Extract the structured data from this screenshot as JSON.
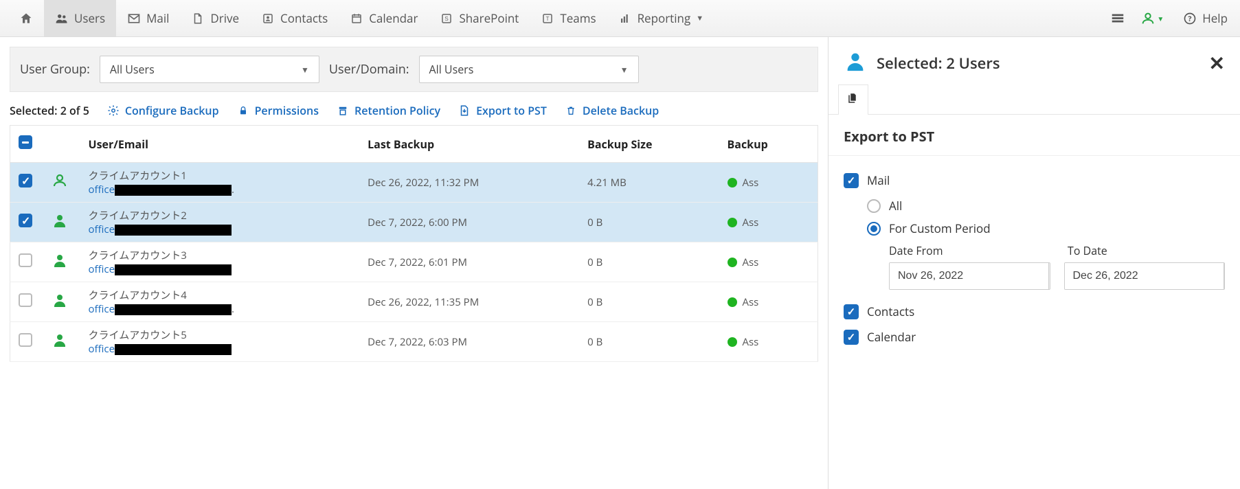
{
  "nav": {
    "items": [
      {
        "label": "",
        "icon": "home"
      },
      {
        "label": "Users",
        "icon": "users",
        "active": true
      },
      {
        "label": "Mail",
        "icon": "mail"
      },
      {
        "label": "Drive",
        "icon": "file"
      },
      {
        "label": "Contacts",
        "icon": "id-card"
      },
      {
        "label": "Calendar",
        "icon": "calendar"
      },
      {
        "label": "SharePoint",
        "icon": "s-box"
      },
      {
        "label": "Teams",
        "icon": "t-box"
      },
      {
        "label": "Reporting",
        "icon": "chart",
        "caret": true
      }
    ],
    "help_label": "Help"
  },
  "filters": {
    "group_label": "User Group:",
    "group_value": "All Users",
    "domain_label": "User/Domain:",
    "domain_value": "All Users"
  },
  "actionbar": {
    "selected_text": "Selected: 2 of 5",
    "configure": "Configure Backup",
    "permissions": "Permissions",
    "retention": "Retention Policy",
    "export": "Export to PST",
    "delete": "Delete Backup"
  },
  "table": {
    "headers": {
      "user": "User/Email",
      "last_backup": "Last Backup",
      "size": "Backup Size",
      "status": "Backup"
    },
    "rows": [
      {
        "selected": true,
        "outline": true,
        "name": "クライムアカウント1",
        "email_prefix": "office",
        "last_backup": "Dec 26, 2022, 11:32 PM",
        "size": "4.21 MB",
        "status": "Ass",
        "trailing_dot": true
      },
      {
        "selected": true,
        "outline": false,
        "name": "クライムアカウント2",
        "email_prefix": "office",
        "last_backup": "Dec 7, 2022, 6:00 PM",
        "size": "0 B",
        "status": "Ass",
        "trailing_dot": false
      },
      {
        "selected": false,
        "outline": false,
        "name": "クライムアカウント3",
        "email_prefix": "office",
        "last_backup": "Dec 7, 2022, 6:01 PM",
        "size": "0 B",
        "status": "Ass",
        "trailing_dot": false
      },
      {
        "selected": false,
        "outline": false,
        "name": "クライムアカウント4",
        "email_prefix": "office",
        "last_backup": "Dec 26, 2022, 11:35 PM",
        "size": "0 B",
        "status": "Ass",
        "trailing_dot": true
      },
      {
        "selected": false,
        "outline": false,
        "name": "クライムアカウント5",
        "email_prefix": "office",
        "last_backup": "Dec 7, 2022, 6:03 PM",
        "size": "0 B",
        "status": "Ass",
        "trailing_dot": false
      }
    ]
  },
  "sidepanel": {
    "header_title": "Selected: 2 Users",
    "section_title": "Export to PST",
    "mail_label": "Mail",
    "radio_all": "All",
    "radio_custom": "For Custom Period",
    "date_from_label": "Date From",
    "date_to_label": "To Date",
    "date_from_value": "Nov 26, 2022",
    "date_to_value": "Dec 26, 2022",
    "contacts_label": "Contacts",
    "calendar_label": "Calendar"
  }
}
